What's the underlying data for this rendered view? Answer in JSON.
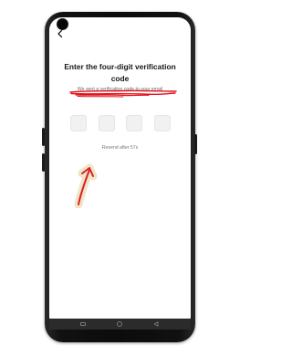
{
  "screen": {
    "title": "Enter the four-digit verification code",
    "subtitle": "We sent a verification code to your email",
    "code_boxes": [
      "",
      "",
      "",
      ""
    ],
    "resend_text": "Resend after 57s"
  },
  "navbar": {
    "recents": "recents-icon",
    "home": "home-icon",
    "back": "back-icon"
  },
  "colors": {
    "annotation_red": "#d8202a",
    "annotation_glow": "#f1e3c2",
    "code_box_bg": "#f1f1f1",
    "phone_frame": "#111111"
  }
}
